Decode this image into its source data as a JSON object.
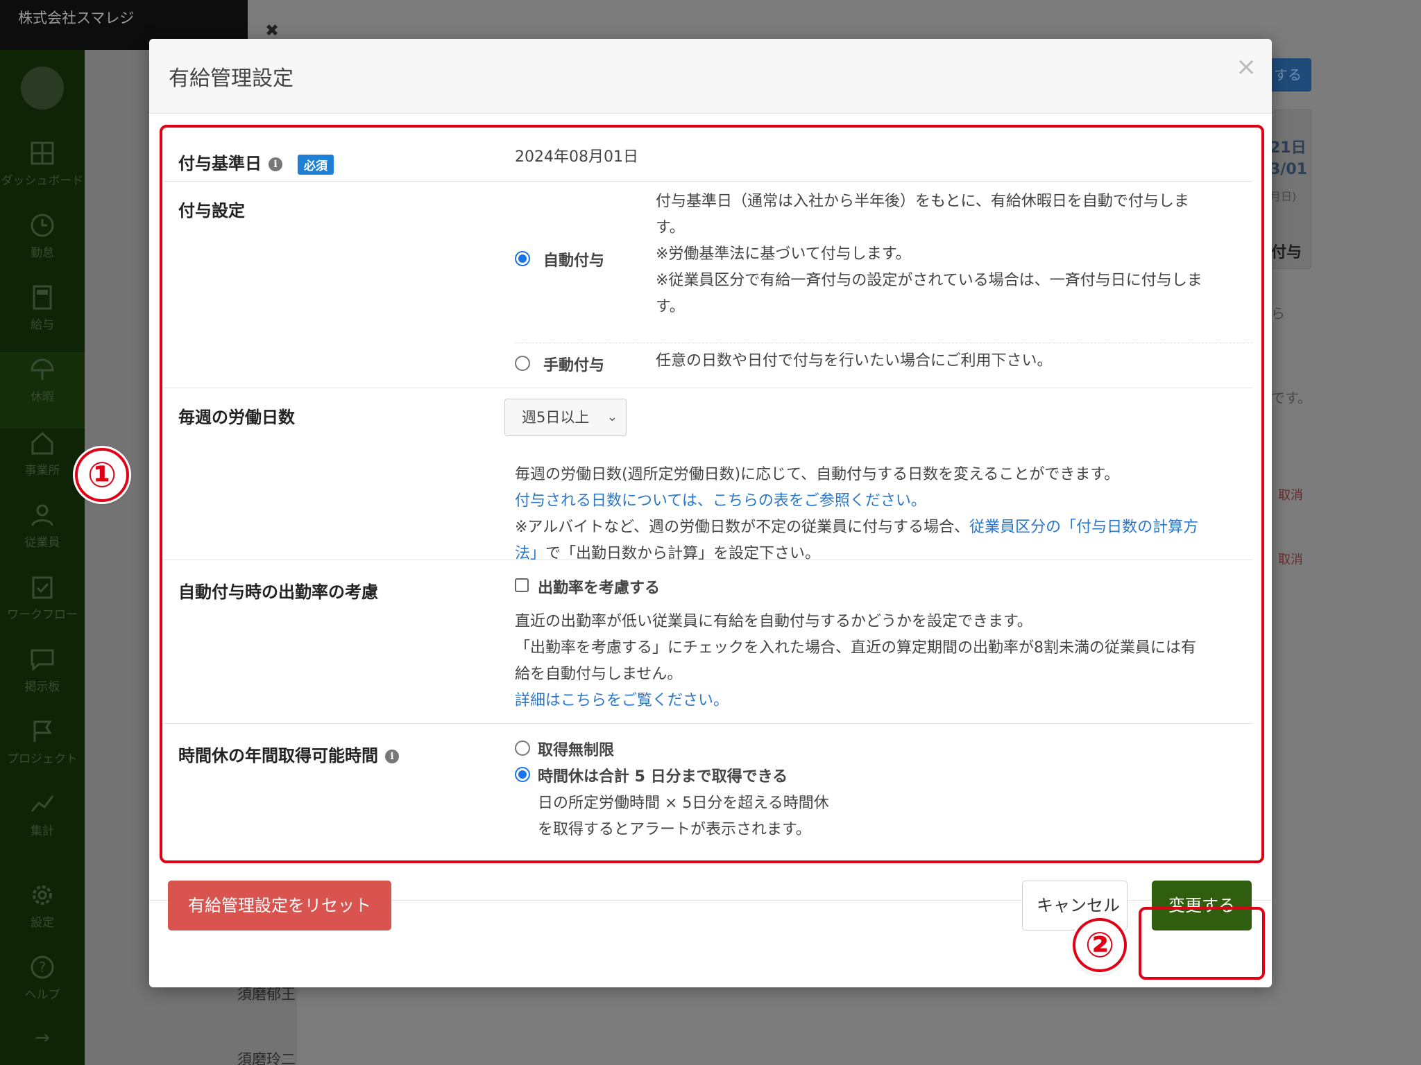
{
  "app": {
    "company": "株式会社スマレジ"
  },
  "sidebar": {
    "items": [
      {
        "label": "ダッシュボード",
        "icon": "dashboard-icon"
      },
      {
        "label": "勤怠",
        "icon": "clock-icon"
      },
      {
        "label": "給与",
        "icon": "calculator-icon"
      },
      {
        "label": "休暇",
        "icon": "umbrella-icon"
      },
      {
        "label": "事業所",
        "icon": "house-icon"
      },
      {
        "label": "従業員",
        "icon": "person-icon"
      },
      {
        "label": "ワークフロー",
        "icon": "clipboard-check-icon"
      },
      {
        "label": "掲示板",
        "icon": "chat-bubble-icon"
      },
      {
        "label": "プロジェクト",
        "icon": "flag-icon"
      },
      {
        "label": "集計",
        "icon": "line-chart-icon"
      },
      {
        "label": "設定",
        "icon": "gear-icon"
      },
      {
        "label": "ヘルプ",
        "icon": "question-icon"
      }
    ],
    "arrow": "→"
  },
  "background": {
    "close": "✖",
    "button_partial": "する",
    "date_a": "21日",
    "date_b": "3/01",
    "date_c": "月日)",
    "fuyo": "付与",
    "copy": "ら",
    "desu": "です。",
    "cancel1": "取消",
    "cancel2": "取消",
    "name1": "須磨郁王",
    "name2": "須磨玲二"
  },
  "modal": {
    "title": "有給管理設定",
    "close_label": "×",
    "grant_base_date": {
      "label": "付与基準日",
      "required_badge": "必須",
      "value": "2024年08月01日"
    },
    "grant_setting": {
      "label": "付与設定",
      "auto": {
        "label": "自動付与",
        "selected": true,
        "desc1": "付与基準日（通常は入社から半年後）をもとに、有給休暇日を自動で付与しま",
        "desc1b": "す。",
        "desc2": "※労働基準法に基づいて付与します。",
        "desc3": "※従業員区分で有給一斉付与の設定がされている場合は、一斉付与日に付与しま",
        "desc3b": "す。"
      },
      "manual": {
        "label": "手動付与",
        "selected": false,
        "desc": "任意の日数や日付で付与を行いたい場合にご利用下さい。"
      }
    },
    "weekly_days": {
      "label": "毎週の労働日数",
      "select_value": "週5日以上",
      "desc1": "毎週の労働日数(週所定労働日数)に応じて、自動付与する日数を変えることができます。",
      "link1": "付与される日数については、こちらの表をご参照ください。",
      "desc2_prefix": "※アルバイトなど、週の労働日数が不定の従業員に付与する場合、",
      "link2a": "従業員区分の「付与日数の計算方",
      "link2b": "法」",
      "desc2_suffix": "で「出勤日数から計算」を設定下さい。"
    },
    "attendance": {
      "label": "自動付与時の出勤率の考慮",
      "checkbox_label": "出勤率を考慮する",
      "checked": false,
      "desc1": "直近の出勤率が低い従業員に有給を自動付与するかどうかを設定できます。",
      "desc2": "「出勤率を考慮する」にチェックを入れた場合、直近の算定期間の出勤率が8割未満の従業員には有",
      "desc2b": "給を自動付与しません。",
      "link": "詳細はこちらをご覧ください。"
    },
    "hourly_leave": {
      "label": "時間休の年間取得可能時間",
      "opt_unlimited": "取得無制限",
      "opt_limited": "時間休は合計 5 日分まで取得できる",
      "selected": "limited",
      "note1": "日の所定労働時間 × 5日分を超える時間休",
      "note2": "を取得するとアラートが表示されます。"
    },
    "footer": {
      "reset": "有給管理設定をリセット",
      "cancel": "キャンセル",
      "submit": "変更する"
    }
  },
  "annotations": {
    "one": "①",
    "two": "②"
  }
}
